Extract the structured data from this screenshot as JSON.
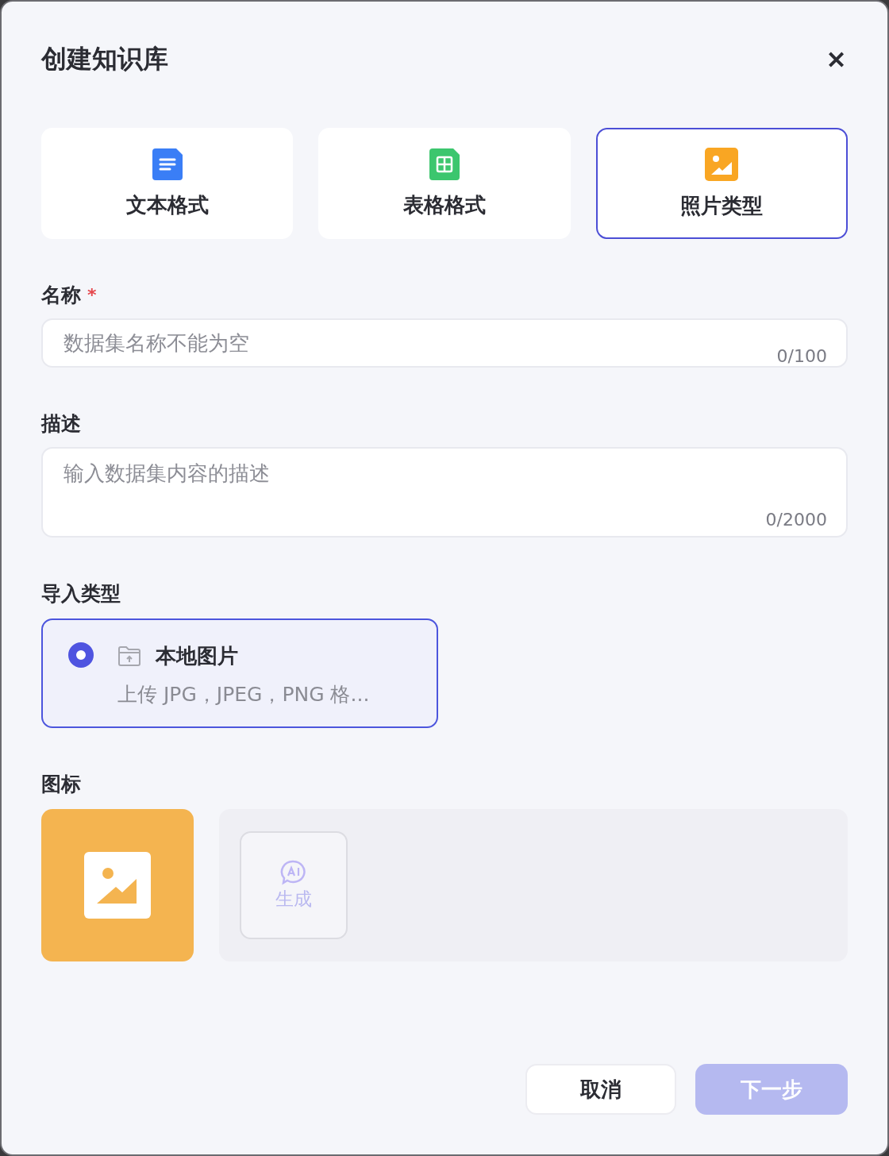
{
  "dialog": {
    "title": "创建知识库",
    "close": "✕"
  },
  "tabs": [
    {
      "label": "文本格式",
      "kind": "text",
      "selected": false
    },
    {
      "label": "表格格式",
      "kind": "table",
      "selected": false
    },
    {
      "label": "照片类型",
      "kind": "photo",
      "selected": true
    }
  ],
  "name_field": {
    "label": "名称",
    "required": "*",
    "placeholder": "数据集名称不能为空",
    "counter": "0/100"
  },
  "description_field": {
    "label": "描述",
    "placeholder": "输入数据集内容的描述",
    "counter": "0/2000"
  },
  "import_type": {
    "label": "导入类型",
    "options": [
      {
        "title": "本地图片",
        "description": "上传 JPG，JPEG，PNG 格...",
        "selected": true
      }
    ]
  },
  "icon_section": {
    "label": "图标",
    "generate_button": "生成"
  },
  "buttons": [
    {
      "label": "取消",
      "kind": "secondary",
      "disabled": false
    },
    {
      "label": "下一步",
      "kind": "primary",
      "disabled": true
    }
  ]
}
